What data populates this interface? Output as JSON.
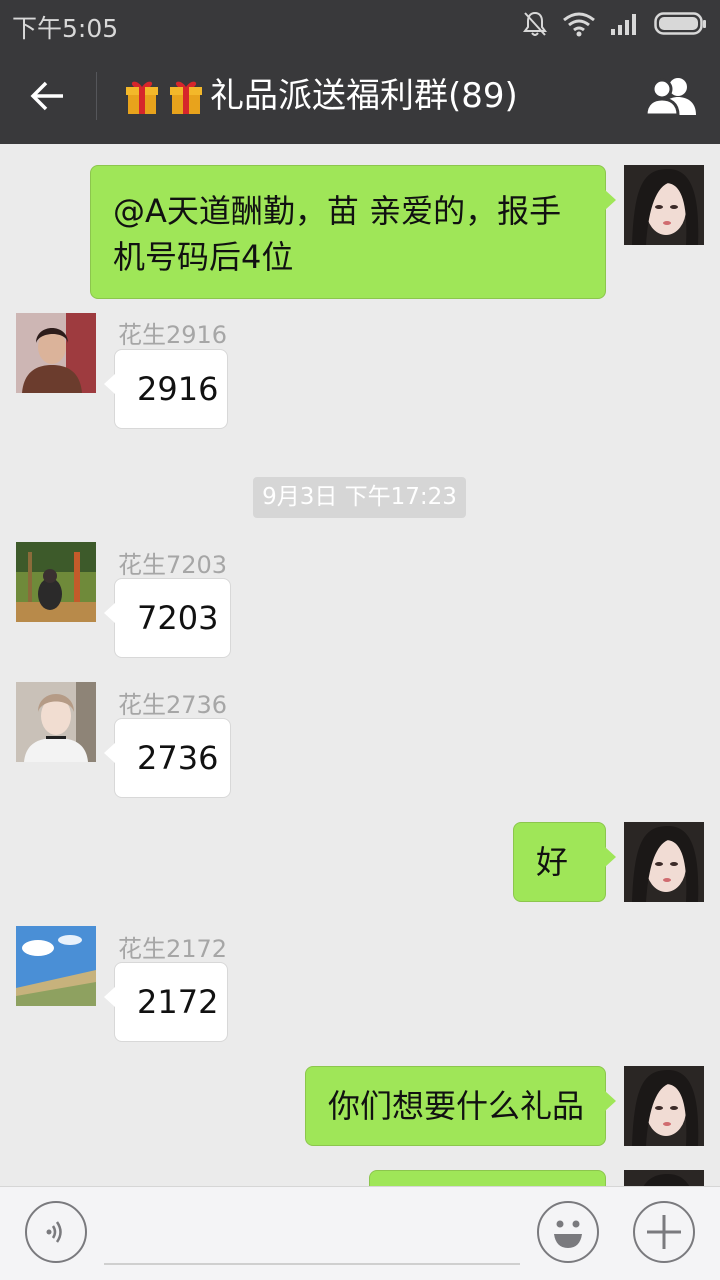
{
  "status_bar": {
    "time": "下午5:05"
  },
  "header": {
    "title": "礼品派送福利群(89)"
  },
  "messages": [
    {
      "side": "me",
      "text": "@A天道酬勤，苗 亲爱的，报手机号码后4位"
    },
    {
      "side": "other",
      "sender": "花生2916",
      "text": "2916"
    },
    {
      "timestamp": "9月3日 下午17:23"
    },
    {
      "side": "other",
      "sender": "花生7203",
      "text": "7203"
    },
    {
      "side": "other",
      "sender": "花生2736",
      "text": "2736"
    },
    {
      "side": "me",
      "text": "好"
    },
    {
      "side": "other",
      "sender": "花生2172",
      "text": "2172"
    },
    {
      "side": "me",
      "text": "你们想要什么礼品"
    }
  ],
  "colors": {
    "header_bg": "#39393b",
    "chat_bg": "#ebebeb",
    "my_bubble": "#9fe658",
    "other_bubble": "#ffffff"
  },
  "icons": {
    "back": "arrow-left-icon",
    "members": "group-members-icon",
    "gift": "gift-box-icon",
    "voice": "voice-icon",
    "emoji": "smiley-icon",
    "more": "plus-icon"
  }
}
